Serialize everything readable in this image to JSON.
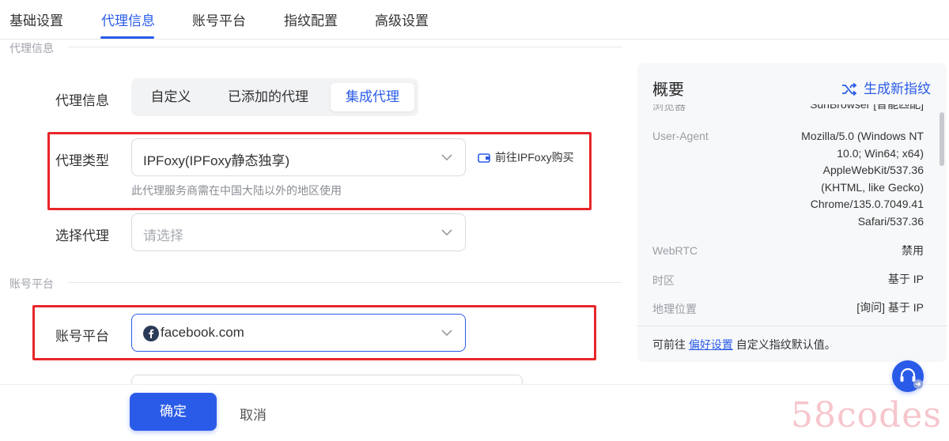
{
  "tabs": [
    {
      "label": "基础设置"
    },
    {
      "label": "代理信息",
      "active": true
    },
    {
      "label": "账号平台"
    },
    {
      "label": "指纹配置"
    },
    {
      "label": "高级设置"
    }
  ],
  "sections": {
    "proxy": "代理信息",
    "account": "账号平台"
  },
  "proxy_info": {
    "label": "代理信息",
    "segments": [
      "自定义",
      "已添加的代理",
      "集成代理"
    ],
    "active_segment": "集成代理"
  },
  "proxy_type": {
    "label": "代理类型",
    "value": "IPFoxy(IPFoxy静态独享)",
    "hint": "此代理服务商需在中国大陆以外的地区使用",
    "buy_link": "前往IPFoxy购买"
  },
  "select_proxy": {
    "label": "选择代理",
    "placeholder": "请选择"
  },
  "account_platform": {
    "label": "账号平台",
    "value": "facebook.com",
    "icon": "facebook-icon"
  },
  "overview": {
    "title": "概要",
    "generate_button": "生成新指纹",
    "partial_row": {
      "key": "浏览器",
      "value": "SunBrowser [智能匹配]"
    },
    "rows": [
      {
        "key": "User-Agent",
        "value_lines": [
          "Mozilla/5.0 (Windows NT",
          "10.0; Win64; x64)",
          "AppleWebKit/537.36",
          "(KHTML, like Gecko)",
          "Chrome/135.0.7049.41",
          "Safari/537.36"
        ]
      },
      {
        "key": "WebRTC",
        "value": "禁用"
      },
      {
        "key": "时区",
        "value": "基于 IP"
      },
      {
        "key": "地理位置",
        "value": "[询问] 基于 IP"
      }
    ],
    "footer_prefix": "可前往",
    "footer_link": "偏好设置",
    "footer_suffix": "自定义指纹默认值。"
  },
  "actions": {
    "confirm": "确定",
    "cancel": "取消"
  },
  "watermark": "58codes",
  "colors": {
    "accent": "#2a5be8",
    "highlight": "#e8262a"
  }
}
